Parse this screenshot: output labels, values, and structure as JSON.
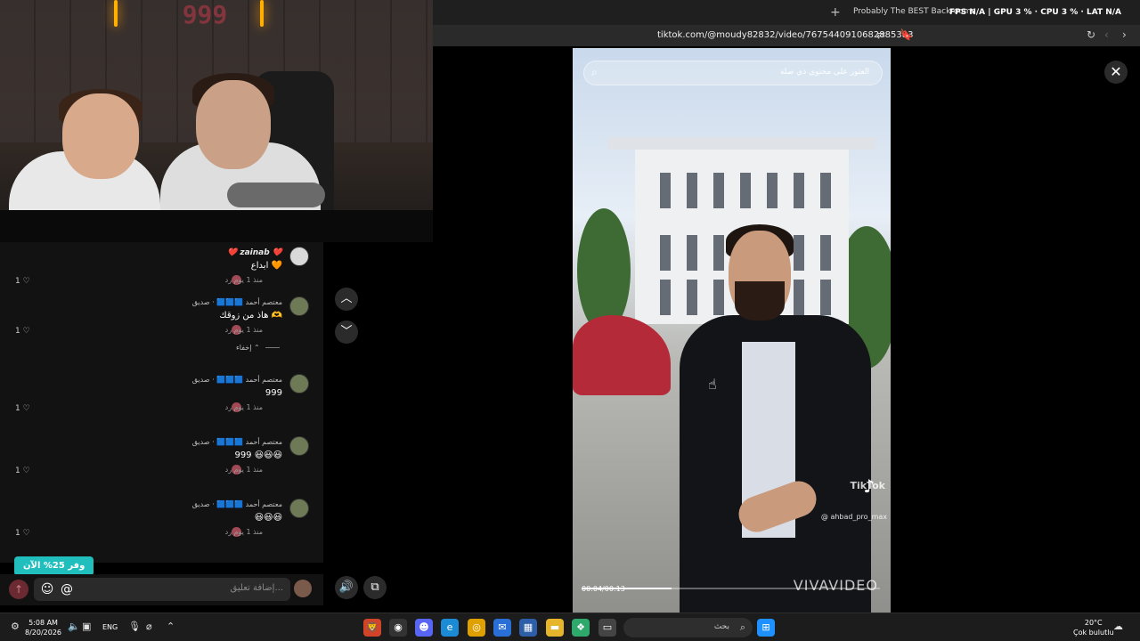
{
  "webcam": {
    "neon_text": "999"
  },
  "browser": {
    "tab_title": "Probably The BEST Backrooms Ga...",
    "osd": "FPS N/A | GPU 3 % · CPU 3 % · LAT N/A",
    "url": "tiktok.com/@moudy82832/video/7675440910682885383"
  },
  "video": {
    "search_placeholder": "العثور على محتوى ذي صلة",
    "watermark": "TikTok",
    "handle": "@ ahbad_pro_max",
    "time": "00:04/00:13",
    "progress": 0.3,
    "brand": "VIVAVIDEO"
  },
  "comments": [
    {
      "name": "❤️ zainab ❤️",
      "text": "ابداع 🧡",
      "meta": "منذ 1 يوم   رد",
      "likes": "1 ♡"
    },
    {
      "name": "معتصم أحمد 🟦🟦🟦 · صديق",
      "text": "هاذ من زوقك 🫶",
      "meta": "منذ 1 يوم   رد",
      "likes": "1 ♡"
    },
    {
      "name": "معتصم أحمد 🟦🟦🟦 · صديق",
      "text": "999",
      "meta": "منذ 1 يوم   رد",
      "likes": "1 ♡"
    },
    {
      "name": "معتصم أحمد 🟦🟦🟦 · صديق",
      "text": "999 😃😃😃",
      "meta": "منذ 1 يوم   رد",
      "likes": "1 ♡"
    },
    {
      "name": "معتصم أحمد 🟦🟦🟦 · صديق",
      "text": "😃😃😃",
      "meta": "منذ 1 يوم   رد",
      "likes": "1 ♡"
    }
  ],
  "hide_label": "إخفاء ⌃",
  "save_badge": "وفر 25% الآن",
  "comment_input_placeholder": "إضافة تعليق...",
  "taskbar": {
    "time": "5:08 AM",
    "date": "8/20/2026",
    "lang": "ENG",
    "search_label": "بحث",
    "temperature": "20°C",
    "weather": "Çok bulutlu"
  },
  "icons": {
    "up": "chevron-up-icon",
    "down": "chevron-down-icon",
    "close": "close-icon",
    "volume": "volume-icon",
    "emoji": "emoji-icon",
    "mention": "mention-icon"
  }
}
